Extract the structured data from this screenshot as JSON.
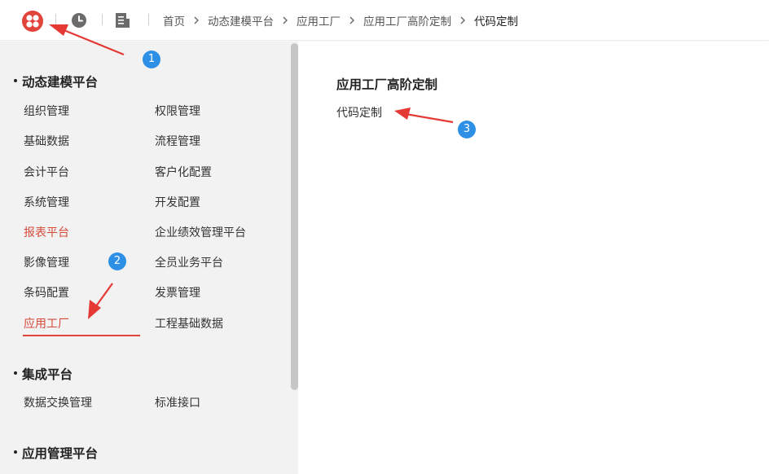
{
  "header": {
    "logo": "app-logo-icon",
    "history_icon": "clock-icon",
    "doc_icon": "document-icon",
    "breadcrumb": [
      "首页",
      "动态建模平台",
      "应用工厂",
      "应用工厂高阶定制",
      "代码定制"
    ]
  },
  "sidebar": {
    "sections": [
      {
        "title": "动态建模平台",
        "items": [
          "组织管理",
          "权限管理",
          "基础数据",
          "流程管理",
          "会计平台",
          "客户化配置",
          "系统管理",
          "开发配置",
          "报表平台",
          "企业绩效管理平台",
          "影像管理",
          "全员业务平台",
          "条码配置",
          "发票管理",
          "应用工厂",
          "工程基础数据"
        ]
      },
      {
        "title": "集成平台",
        "items": [
          "数据交换管理",
          "标准接口"
        ]
      },
      {
        "title": "应用管理平台",
        "items": []
      }
    ],
    "active_item": "应用工厂",
    "highlighted_item": "报表平台"
  },
  "content": {
    "title": "应用工厂高阶定制",
    "links": [
      "代码定制"
    ]
  },
  "annotations": {
    "badges": [
      "1",
      "2",
      "3"
    ],
    "color": "#2e8fe6",
    "arrow_color": "#e53935"
  },
  "colors": {
    "accent_red": "#e0443a",
    "sidebar_bg": "#f2f2f2"
  }
}
